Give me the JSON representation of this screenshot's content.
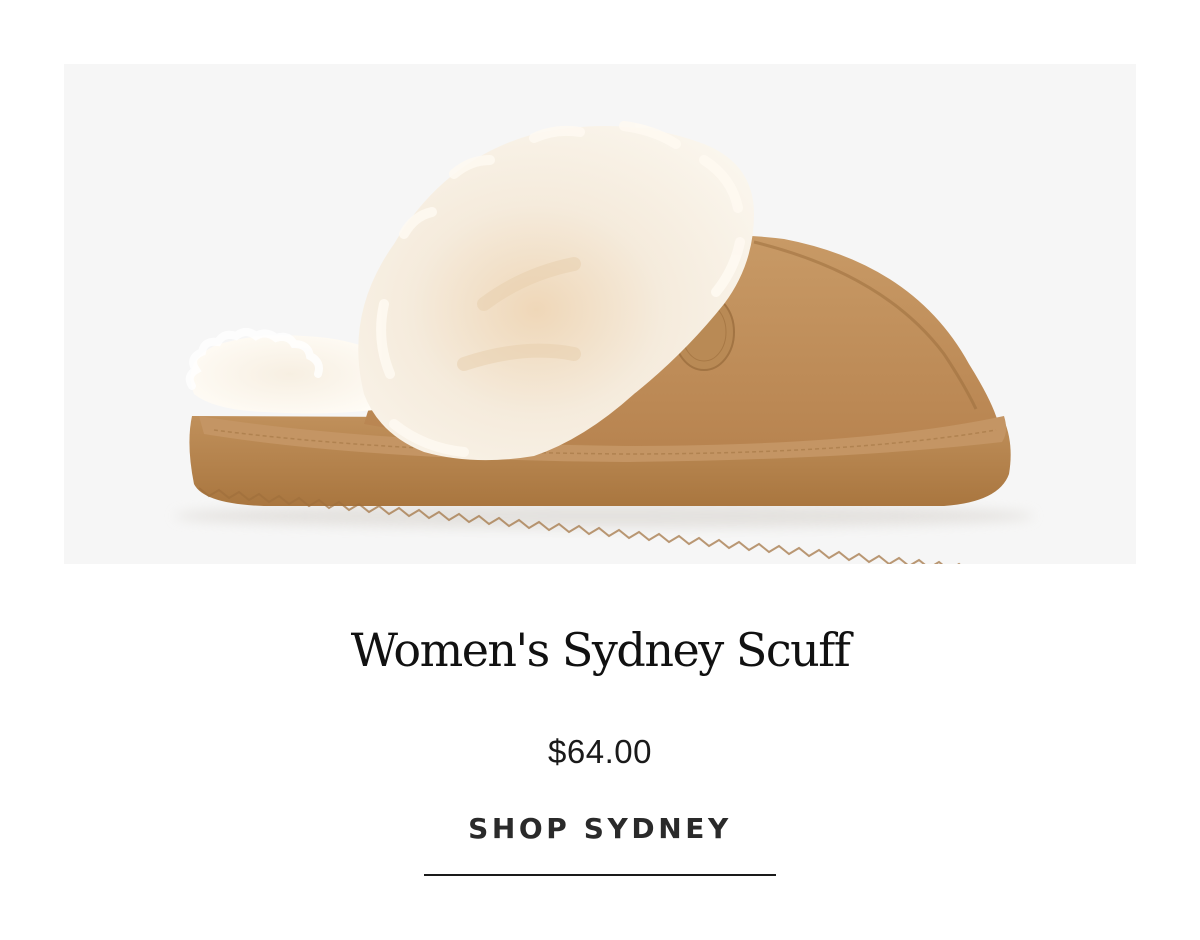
{
  "product": {
    "image_alt": "Women's Sydney Scuff slipper",
    "title": "Women's Sydney Scuff",
    "price": "$64.00",
    "cta_label": "SHOP SYDNEY"
  },
  "colors": {
    "image_background": "#f6f6f6",
    "suede": "#c29563",
    "sole": "#b88551",
    "shearling": "#f3ecdf",
    "text": "#111111",
    "underline": "#1a1a1a"
  }
}
